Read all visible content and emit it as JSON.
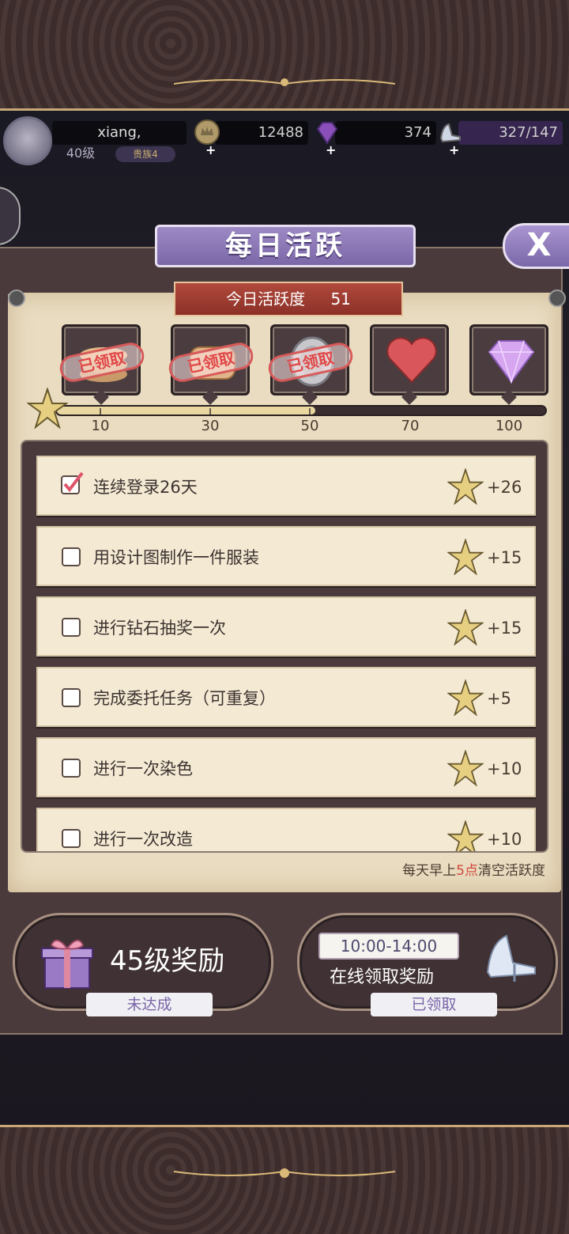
{
  "header": {
    "username": "xiang,",
    "level": "40级",
    "rank": "贵族4",
    "coins": "12488",
    "gems": "374",
    "stamina": "327/147"
  },
  "panel": {
    "title": "每日活跃",
    "close_label": "X",
    "activity_label": "今日活跃度",
    "activity_value": "51"
  },
  "milestones": [
    {
      "value": "10",
      "icon": "coin-stack-icon",
      "claimed": true,
      "claimed_label": "已领取"
    },
    {
      "value": "30",
      "icon": "bread-icon",
      "claimed": true,
      "claimed_label": "已领取"
    },
    {
      "value": "50",
      "icon": "silver-coin-icon",
      "claimed": true,
      "claimed_label": "已领取"
    },
    {
      "value": "70",
      "icon": "heart-icon",
      "claimed": false
    },
    {
      "value": "100",
      "icon": "diamond-icon",
      "claimed": false
    }
  ],
  "progress": {
    "current": 51,
    "max": 100
  },
  "tasks": [
    {
      "label": "连续登录26天",
      "points": "+26",
      "done": true
    },
    {
      "label": "用设计图制作一件服装",
      "points": "+15",
      "done": false
    },
    {
      "label": "进行钻石抽奖一次",
      "points": "+15",
      "done": false
    },
    {
      "label": "完成委托任务（可重复）",
      "points": "+5",
      "done": false
    },
    {
      "label": "进行一次染色",
      "points": "+10",
      "done": false
    },
    {
      "label": "进行一次改造",
      "points": "+10",
      "done": false
    }
  ],
  "reset_note": {
    "before": "每天早上",
    "highlight": "5点",
    "after": "清空活跃度"
  },
  "cards": {
    "level_reward": {
      "title": "45级奖励",
      "status": "未达成"
    },
    "online_reward": {
      "time": "10:00-14:00",
      "title": "在线领取奖励",
      "status": "已领取"
    }
  },
  "colors": {
    "accent_purple": "#7b67a7",
    "ribbon_red": "#b04a3c",
    "claimed_red": "#e04848",
    "parchment": "#e9dcc0"
  }
}
